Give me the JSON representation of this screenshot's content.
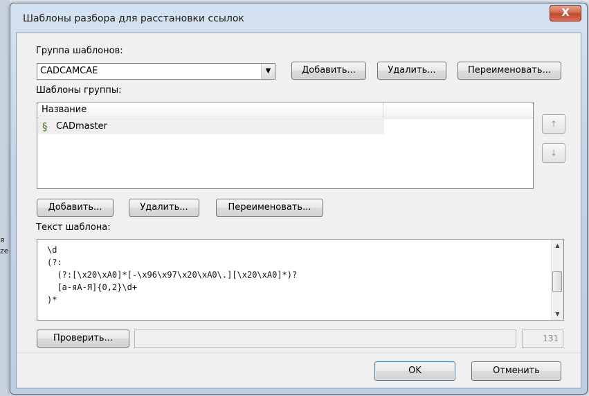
{
  "background": {
    "frag1": "я",
    "frag2": "ze"
  },
  "window": {
    "title": "Шаблоны разбора для расстановки ссылок",
    "close_glyph": "X"
  },
  "group": {
    "label": "Группа шаблонов:",
    "selected": "CADCAMCAE",
    "add_label": "Добавить...",
    "delete_label": "Удалить...",
    "rename_label": "Переименовать..."
  },
  "templates": {
    "label": "Шаблоны группы:",
    "column_name": "Название",
    "items": [
      {
        "name": "CADmaster"
      }
    ],
    "up_glyph": "↑",
    "down_glyph": "↓",
    "add_label": "Добавить...",
    "delete_label": "Удалить...",
    "rename_label": "Переименовать..."
  },
  "template_text": {
    "label": "Текст шаблона:",
    "lines": [
      "\\d",
      "(?:",
      "  (?:[\\x20\\xA0]*[-\\x96\\x97\\x20\\xA0\\.][\\x20\\xA0]*)?",
      "  [a-яА-Я]{0,2}\\d+",
      ")*"
    ],
    "scroll_up": "▲",
    "scroll_down": "▼"
  },
  "check": {
    "label": "Проверить...",
    "result": "",
    "count": "131"
  },
  "footer": {
    "ok_label": "OK",
    "cancel_label": "Отменить"
  },
  "colors": {
    "title_bar": "#c3d4e8",
    "close_button": "#c0482c",
    "dialog_body": "#f0f0f0"
  }
}
